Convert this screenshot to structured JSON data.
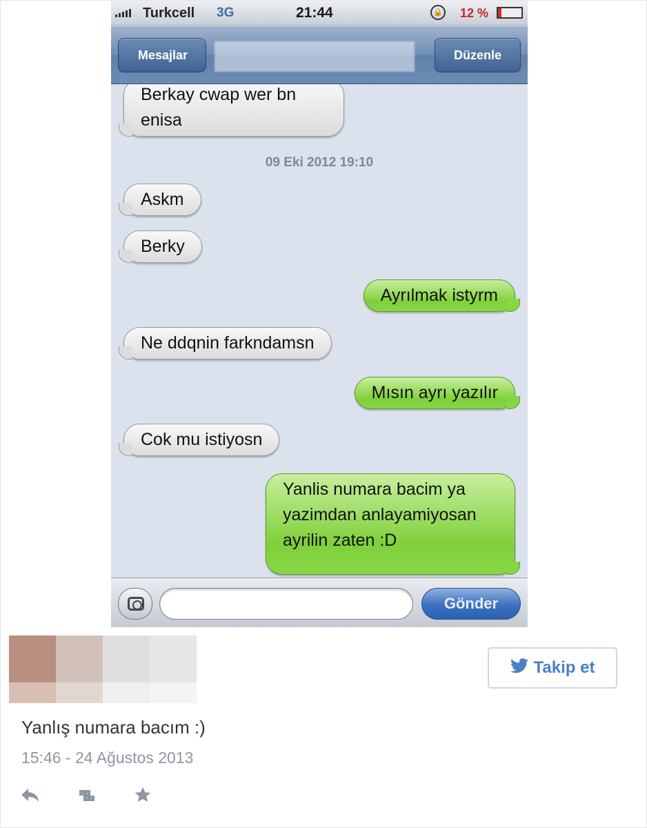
{
  "status_bar": {
    "carrier": "Turkcell",
    "network": "3G",
    "time": "21:44",
    "battery": "12 %"
  },
  "nav_bar": {
    "back_label": "Mesajlar",
    "edit_label": "Düzenle"
  },
  "messages": [
    {
      "direction": "incoming",
      "text": "Berkay cwap wer bn enisa"
    },
    {
      "direction": "timestamp",
      "text": "09 Eki 2012 19:10"
    },
    {
      "direction": "incoming",
      "text": "Askm"
    },
    {
      "direction": "incoming",
      "text": "Berky"
    },
    {
      "direction": "outgoing",
      "text": "Ayrılmak istyrm"
    },
    {
      "direction": "incoming",
      "text": "Ne ddqnin farkndamsn"
    },
    {
      "direction": "outgoing",
      "text": "Mısın ayrı yazılır"
    },
    {
      "direction": "incoming",
      "text": "Cok mu istiyosn"
    },
    {
      "direction": "outgoing",
      "text": "Yanlis numara bacim ya yazimdan anlayamiyosan ayrilin zaten :D"
    }
  ],
  "composer": {
    "send_label": "Gönder"
  },
  "tweet": {
    "follow_label": "Takip et",
    "text": "Yanlış numara bacım :)",
    "timestamp": "15:46 - 24 Ağustos 2013"
  },
  "colors": {
    "incoming_bubble": "#e8e8e8",
    "outgoing_bubble": "#86d745",
    "twitter_blue": "#4a81c6",
    "send_button": "#3c70bf"
  }
}
